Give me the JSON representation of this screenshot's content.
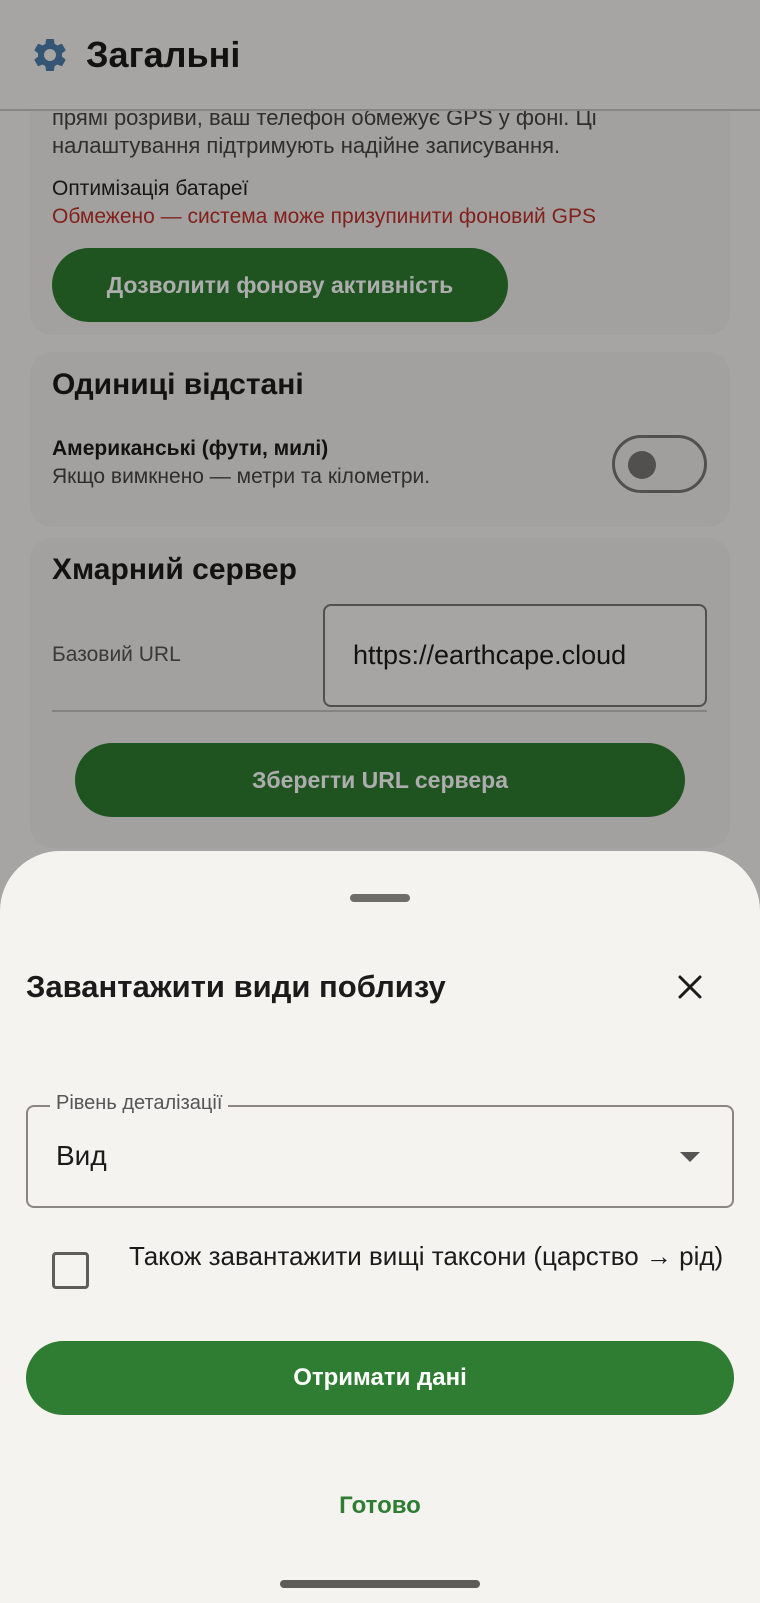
{
  "app_bar": {
    "title": "Загальні",
    "icon": "gear-icon"
  },
  "background_page": {
    "battery_section": {
      "intro_text": "прямі розриви, ваш телефон обмежує GPS у фоні. Ці налаштування підтримують надійне записування.",
      "battery_label": "Оптимізація батареї",
      "battery_status": "Обмежено — система може призупинити фоновий GPS",
      "allow_button": "Дозволити фонову активність",
      "status_color": "#c0302a"
    },
    "units_section": {
      "title": "Одиниці відстані",
      "option_label": "Американські (фути, милі)",
      "option_sub": "Якщо вимкнено — метри та кілометри.",
      "toggle_on": false
    },
    "cloud_section": {
      "title": "Хмарний сервер",
      "url_label": "Базовий URL",
      "url_value": "https://earthcape.cloud",
      "save_button": "Зберегти URL сервера"
    }
  },
  "sheet": {
    "title": "Завантажити види поблизу",
    "detail_level": {
      "label": "Рівень деталізації",
      "value": "Вид"
    },
    "higher_taxa": {
      "label": "Також завантажити вищі таксони (царство → рід)",
      "checked": false
    },
    "fetch_button": "Отримати дані",
    "done_button": "Готово"
  },
  "colors": {
    "accent_green": "#2e7d32",
    "background": "#f5f3ef"
  }
}
